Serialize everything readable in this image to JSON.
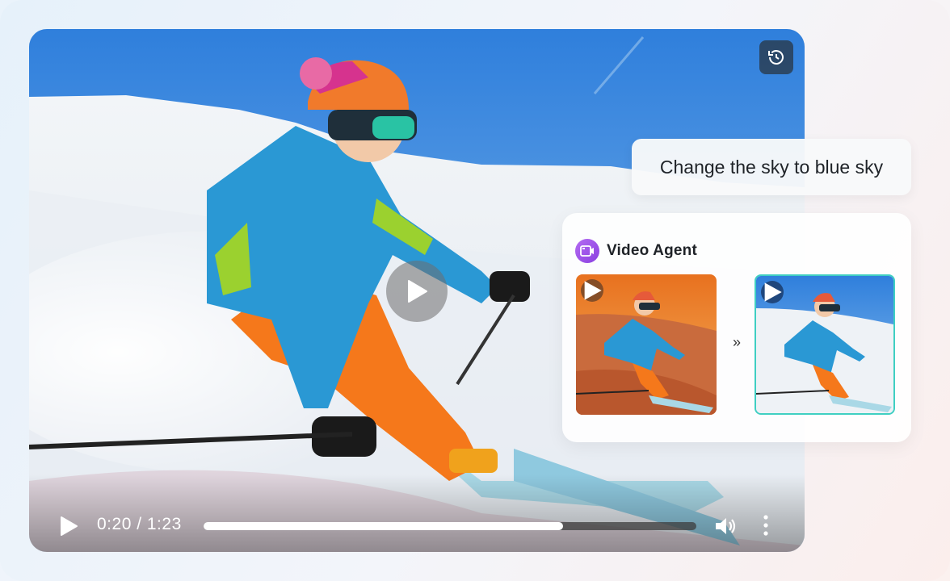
{
  "player": {
    "time_display": "0:20 / 1:23",
    "progress_fraction": 0.73,
    "history_icon": "history-icon",
    "play_icon": "play-icon",
    "volume_icon": "volume-icon",
    "more_icon": "more-vertical-icon"
  },
  "prompt": {
    "text": "Change the sky to blue sky"
  },
  "agent": {
    "title": "Video Agent",
    "icon": "video-agent-icon",
    "arrow": "»",
    "accent_color": "#3fcfc2",
    "icon_color": "#a052e8"
  }
}
